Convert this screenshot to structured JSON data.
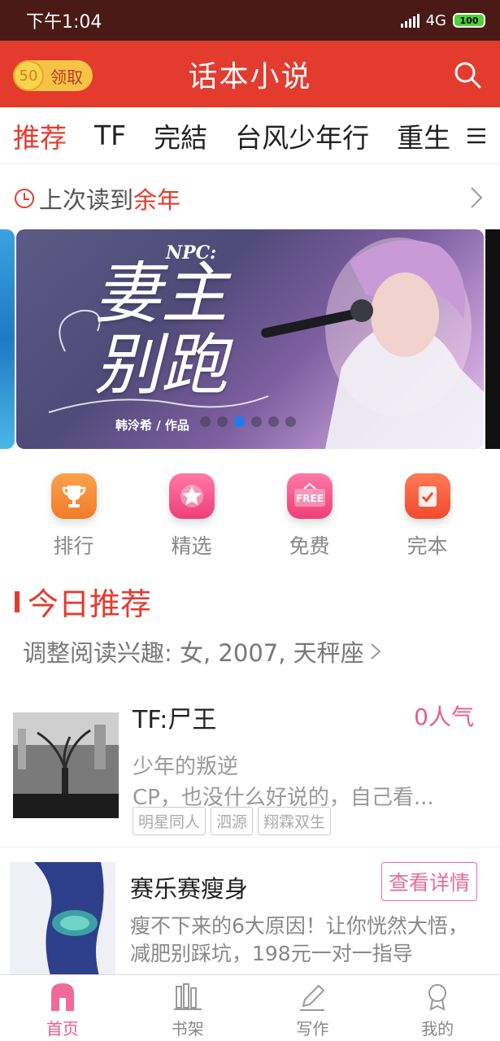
{
  "status_bar": {
    "time": "下午1:04",
    "network": "4G",
    "battery": "100"
  },
  "app_bar": {
    "coin_value": "50",
    "claim_label": "领取",
    "title": "话本小说"
  },
  "tabs": [
    {
      "label": "推荐",
      "active": true
    },
    {
      "label": "TF",
      "active": false
    },
    {
      "label": "完結",
      "active": false
    },
    {
      "label": "台风少年行",
      "active": false
    },
    {
      "label": "重生",
      "active": false
    }
  ],
  "last_read": {
    "prefix": "上次读到",
    "book": "余年"
  },
  "banner": {
    "npc_label": "NPC:",
    "cover_title": "妻主别跑",
    "cover_author": "韩泠希 / 作品",
    "slide_count": 6,
    "active_slide": 3
  },
  "shortcuts": [
    {
      "label": "排行",
      "icon": "trophy-icon",
      "color": "#f7943a"
    },
    {
      "label": "精选",
      "icon": "star-icon",
      "color": "#f25a8e"
    },
    {
      "label": "免费",
      "icon": "free-icon",
      "color": "#f25a8e"
    },
    {
      "label": "完本",
      "icon": "checklist-icon",
      "color": "#f5633f"
    }
  ],
  "today": {
    "title": "今日推荐",
    "interest": "调整阅读兴趣: 女, 2007, 天秤座"
  },
  "book": {
    "title": "TF:尸王",
    "popularity": "0人气",
    "subtitle": "少年的叛逆",
    "description": "CP，也没什么好说的，自己看...",
    "tags": [
      "明星同人",
      "泗源",
      "翔霖双生"
    ]
  },
  "ad": {
    "title": "赛乐赛瘦身",
    "button": "查看详情",
    "description": "瘦不下来的6大原因！让你恍然大悟，减肥别踩坑，198元一对一指导"
  },
  "bottom_nav": [
    {
      "label": "首页",
      "icon": "home-icon",
      "active": true
    },
    {
      "label": "书架",
      "icon": "bookshelf-icon",
      "active": false
    },
    {
      "label": "写作",
      "icon": "pen-icon",
      "active": false
    },
    {
      "label": "我的",
      "icon": "profile-icon",
      "active": false
    }
  ],
  "colors": {
    "brand_red": "#e33b2e",
    "accent_pink": "#ea5a8c",
    "status_bar": "#4a1a16"
  }
}
